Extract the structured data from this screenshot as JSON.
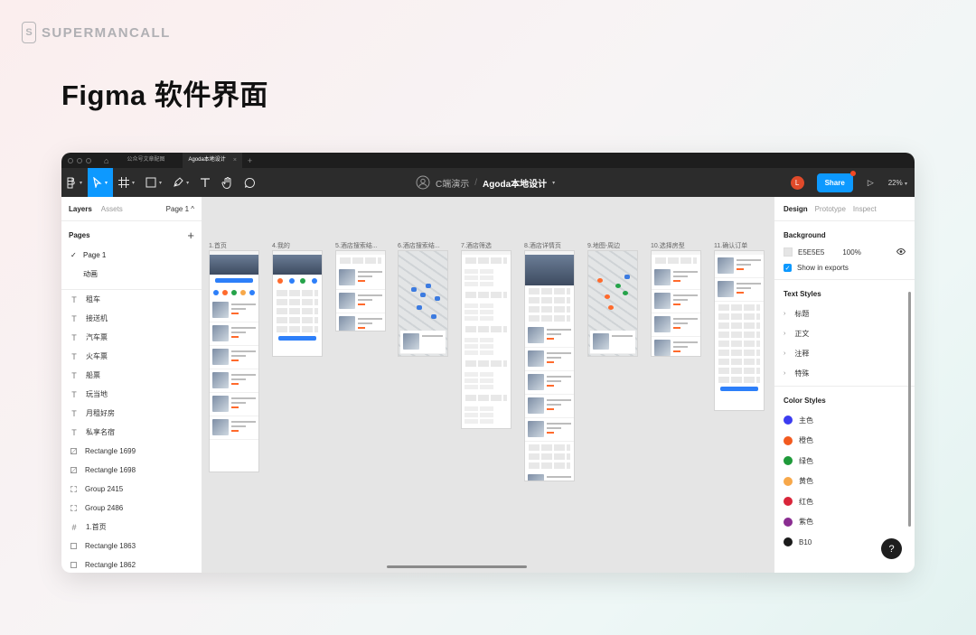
{
  "brand": {
    "name": "SUPERMANCALL",
    "logo_glyph": "S"
  },
  "hero_title": "Figma 软件界面",
  "window": {
    "tabs": {
      "home_icon": "home-icon",
      "items": [
        "公众号文章配图",
        "Agoda本地设计"
      ],
      "add": "+",
      "close": "×"
    },
    "toolbar": {
      "tools": [
        "main-menu-icon",
        "move-icon",
        "frame-icon",
        "shape-icon",
        "pen-icon",
        "text-icon",
        "hand-icon",
        "comment-icon"
      ],
      "project": "C端演示",
      "separator": "/",
      "file_name": "Agoda本地设计",
      "avatar": "L",
      "share": "Share",
      "zoom": "22%"
    },
    "left_panel": {
      "tabs": [
        "Layers",
        "Assets"
      ],
      "page_selector": "Page 1 ^",
      "pages_title": "Pages",
      "add": "+",
      "pages": [
        {
          "label": "Page 1",
          "current": true
        },
        {
          "label": "动画",
          "current": false
        }
      ],
      "layers": [
        {
          "icon": "text",
          "label": "租车"
        },
        {
          "icon": "text",
          "label": "接送机"
        },
        {
          "icon": "text",
          "label": "汽车票"
        },
        {
          "icon": "text",
          "label": "火车票"
        },
        {
          "icon": "text",
          "label": "船票"
        },
        {
          "icon": "text",
          "label": "玩当地"
        },
        {
          "icon": "text",
          "label": "月租好房"
        },
        {
          "icon": "text",
          "label": "私享名宿"
        },
        {
          "icon": "image",
          "label": "Rectangle 1699"
        },
        {
          "icon": "image",
          "label": "Rectangle 1698"
        },
        {
          "icon": "group",
          "label": "Group 2415"
        },
        {
          "icon": "group",
          "label": "Group 2486"
        },
        {
          "icon": "frame",
          "label": "1.首页"
        },
        {
          "icon": "rect",
          "label": "Rectangle 1863"
        },
        {
          "icon": "rect",
          "label": "Rectangle 1862"
        }
      ]
    },
    "canvas": {
      "background": "#e5e5e5",
      "frames": [
        {
          "label": "1.首页",
          "kind": "home"
        },
        {
          "label": "4.我的",
          "kind": "profile"
        },
        {
          "label": "5.酒店搜索结...",
          "kind": "list"
        },
        {
          "label": "6.酒店搜索结...",
          "kind": "map"
        },
        {
          "label": "7.酒店筛选",
          "kind": "filter"
        },
        {
          "label": "8.酒店详情页",
          "kind": "detail"
        },
        {
          "label": "9.地图-周边",
          "kind": "map2"
        },
        {
          "label": "10.选择房型",
          "kind": "rooms"
        },
        {
          "label": "11.确认订单",
          "kind": "order"
        }
      ]
    },
    "right_panel": {
      "tabs": [
        "Design",
        "Prototype",
        "Inspect"
      ],
      "background": {
        "title": "Background",
        "hex": "E5E5E5",
        "opacity": "100%",
        "show_in_exports": "Show in exports"
      },
      "text_styles": {
        "title": "Text Styles",
        "items": [
          "标题",
          "正文",
          "注释",
          "特殊"
        ]
      },
      "color_styles": {
        "title": "Color Styles",
        "items": [
          {
            "label": "主色",
            "color": "#3c3cf0"
          },
          {
            "label": "橙色",
            "color": "#f25a1f"
          },
          {
            "label": "绿色",
            "color": "#1f9a3a"
          },
          {
            "label": "黄色",
            "color": "#f7a84a"
          },
          {
            "label": "红色",
            "color": "#d9253a"
          },
          {
            "label": "紫色",
            "color": "#8a2d91"
          },
          {
            "label": "B10",
            "color": "#1a1a1a"
          }
        ]
      },
      "help": "?"
    }
  }
}
